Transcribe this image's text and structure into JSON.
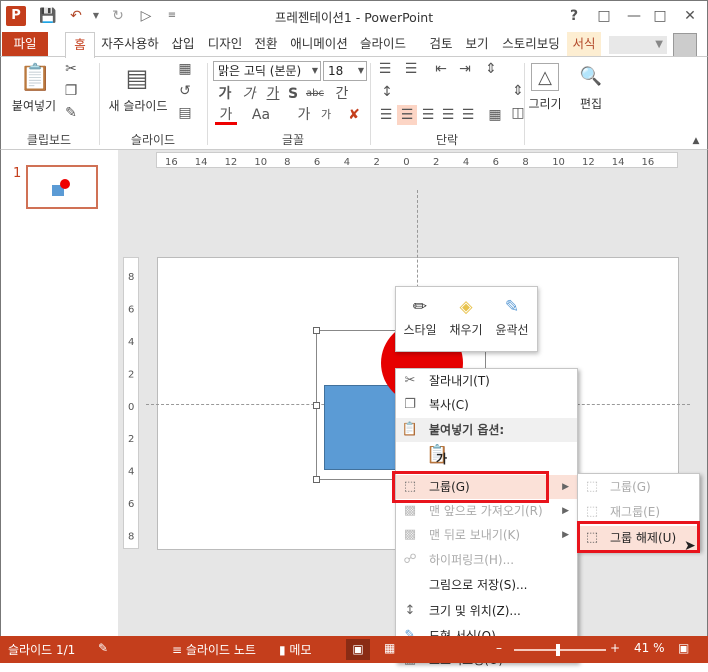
{
  "window": {
    "title": "프레젠테이션1 - PowerPoint",
    "help": "?",
    "app_icon": "P"
  },
  "tabs": [
    "파일",
    "홈",
    "자주사용하",
    "삽입",
    "디자인",
    "전환",
    "애니메이션",
    "슬라이드",
    "검토",
    "보기",
    "스토리보딩",
    "서식"
  ],
  "ribbon": {
    "paste": "붙여넣기",
    "new_slide": "새 슬라이드",
    "font_name": "맑은 고딕 (본문)",
    "font_size": "18",
    "font_row1": [
      "가",
      "가",
      "가",
      "S",
      "abc",
      "간"
    ],
    "font_row2": [
      "가",
      "Aa",
      "가",
      "가"
    ],
    "drawing": "그리기",
    "editing": "편집",
    "groups": [
      "클립보드",
      "슬라이드",
      "글꼴",
      "단락"
    ]
  },
  "thumbs": {
    "number": "1"
  },
  "ruler": {
    "h": [
      "16",
      "14",
      "12",
      "10",
      "8",
      "6",
      "4",
      "2",
      "0",
      "2",
      "4",
      "6",
      "8",
      "10",
      "12",
      "14",
      "16"
    ],
    "v": [
      "8",
      "6",
      "4",
      "2",
      "0",
      "2",
      "4",
      "6",
      "8"
    ]
  },
  "minibar": {
    "items": [
      {
        "label": "스타일",
        "icon": "style-icon"
      },
      {
        "label": "채우기",
        "icon": "fill-icon"
      },
      {
        "label": "윤곽선",
        "icon": "outline-icon"
      }
    ]
  },
  "context_menu": {
    "items": [
      {
        "label": "잘라내기(T)",
        "icon": "scissors-icon",
        "state": "normal"
      },
      {
        "label": "복사(C)",
        "icon": "copy-icon",
        "state": "normal"
      },
      {
        "label": "붙여넣기 옵션:",
        "icon": "paste-icon",
        "state": "header"
      },
      {
        "label": "가",
        "icon": "paste-keep-icon",
        "state": "normal"
      },
      {
        "label": "그룹(G)",
        "icon": "group-icon",
        "state": "hover",
        "submenu": true
      },
      {
        "label": "맨 앞으로 가져오기(R)",
        "icon": "bring-front-icon",
        "state": "disabled",
        "submenu": true
      },
      {
        "label": "맨 뒤로 보내기(K)",
        "icon": "send-back-icon",
        "state": "disabled",
        "submenu": true
      },
      {
        "label": "하이퍼링크(H)...",
        "icon": "link-icon",
        "state": "disabled"
      },
      {
        "label": "그림으로 저장(S)...",
        "icon": "",
        "state": "normal"
      },
      {
        "label": "크기 및 위치(Z)...",
        "icon": "size-icon",
        "state": "normal"
      },
      {
        "label": "도형 서식(O)...",
        "icon": "format-shape-icon",
        "state": "normal"
      },
      {
        "label": "스토리보딩(O)",
        "icon": "storyboard-icon",
        "state": "normal",
        "submenu": true
      }
    ]
  },
  "submenu": {
    "items": [
      {
        "label": "그룹(G)",
        "state": "disabled"
      },
      {
        "label": "재그룹(E)",
        "state": "disabled"
      },
      {
        "label": "그룹 해제(U)",
        "state": "hover"
      }
    ]
  },
  "status": {
    "slide": "슬라이드 1/1",
    "notes": "슬라이드 노트",
    "comments": "메모",
    "zoom": "41 %"
  },
  "colors": {
    "accent": "#c43e1c",
    "highlight": "#e8141c"
  }
}
